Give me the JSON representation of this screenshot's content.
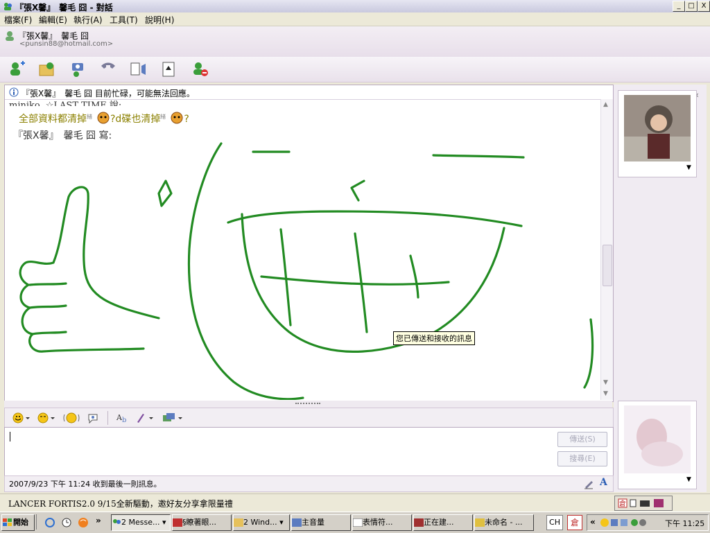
{
  "window": {
    "title": "『張X馨』　馨毛 囧 - 對話",
    "controls": [
      "_",
      "□",
      "X"
    ]
  },
  "menu": [
    "檔案(F)",
    "編輯(E)",
    "執行(A)",
    "工具(T)",
    "說明(H)"
  ],
  "contact": {
    "name": "『張X馨』　馨毛 囧",
    "email": "<punsin88@hotmail.com>"
  },
  "toolbar_icons": [
    "invite-icon",
    "send-files-icon",
    "video-icon",
    "call-icon",
    "activities-icon",
    "games-icon",
    "block-icon"
  ],
  "chat": {
    "notice": "『張X馨』　馨毛 囧 目前忙碌，可能無法回應。",
    "lines": [
      {
        "text": "miniko..☆LAST TIME 說:"
      },
      {
        "text": "全部資料都清掉",
        "text2": "?d碟也清掉",
        "text3": "?"
      },
      {
        "text": "『張X馨』　馨毛 囧 寫:"
      }
    ],
    "tooltip": "您已傳送和接收的訊息"
  },
  "input": {
    "send_label": "傳送(S)",
    "search_label": "搜尋(E)"
  },
  "status_line": "2007/9/23 下午 11:24 收到最後一則訊息。",
  "ad_text": "LANCER FORTIS2.0 9/15全新驅動，邀好友分享拿限量禮",
  "taskbar": {
    "start": "開始",
    "tasks": [
      {
        "label": "2 Messe..."
      },
      {
        "label": "§瞭著眼..."
      },
      {
        "label": "2 Wind..."
      },
      {
        "label": "主音量"
      },
      {
        "label": "表情符..."
      },
      {
        "label": "正在建..."
      },
      {
        "label": "未命名 - ..."
      }
    ],
    "ime": "CH",
    "clock": "下午 11:25"
  },
  "colors": {
    "ink": "#228B22",
    "link_olive": "#8B8000"
  }
}
